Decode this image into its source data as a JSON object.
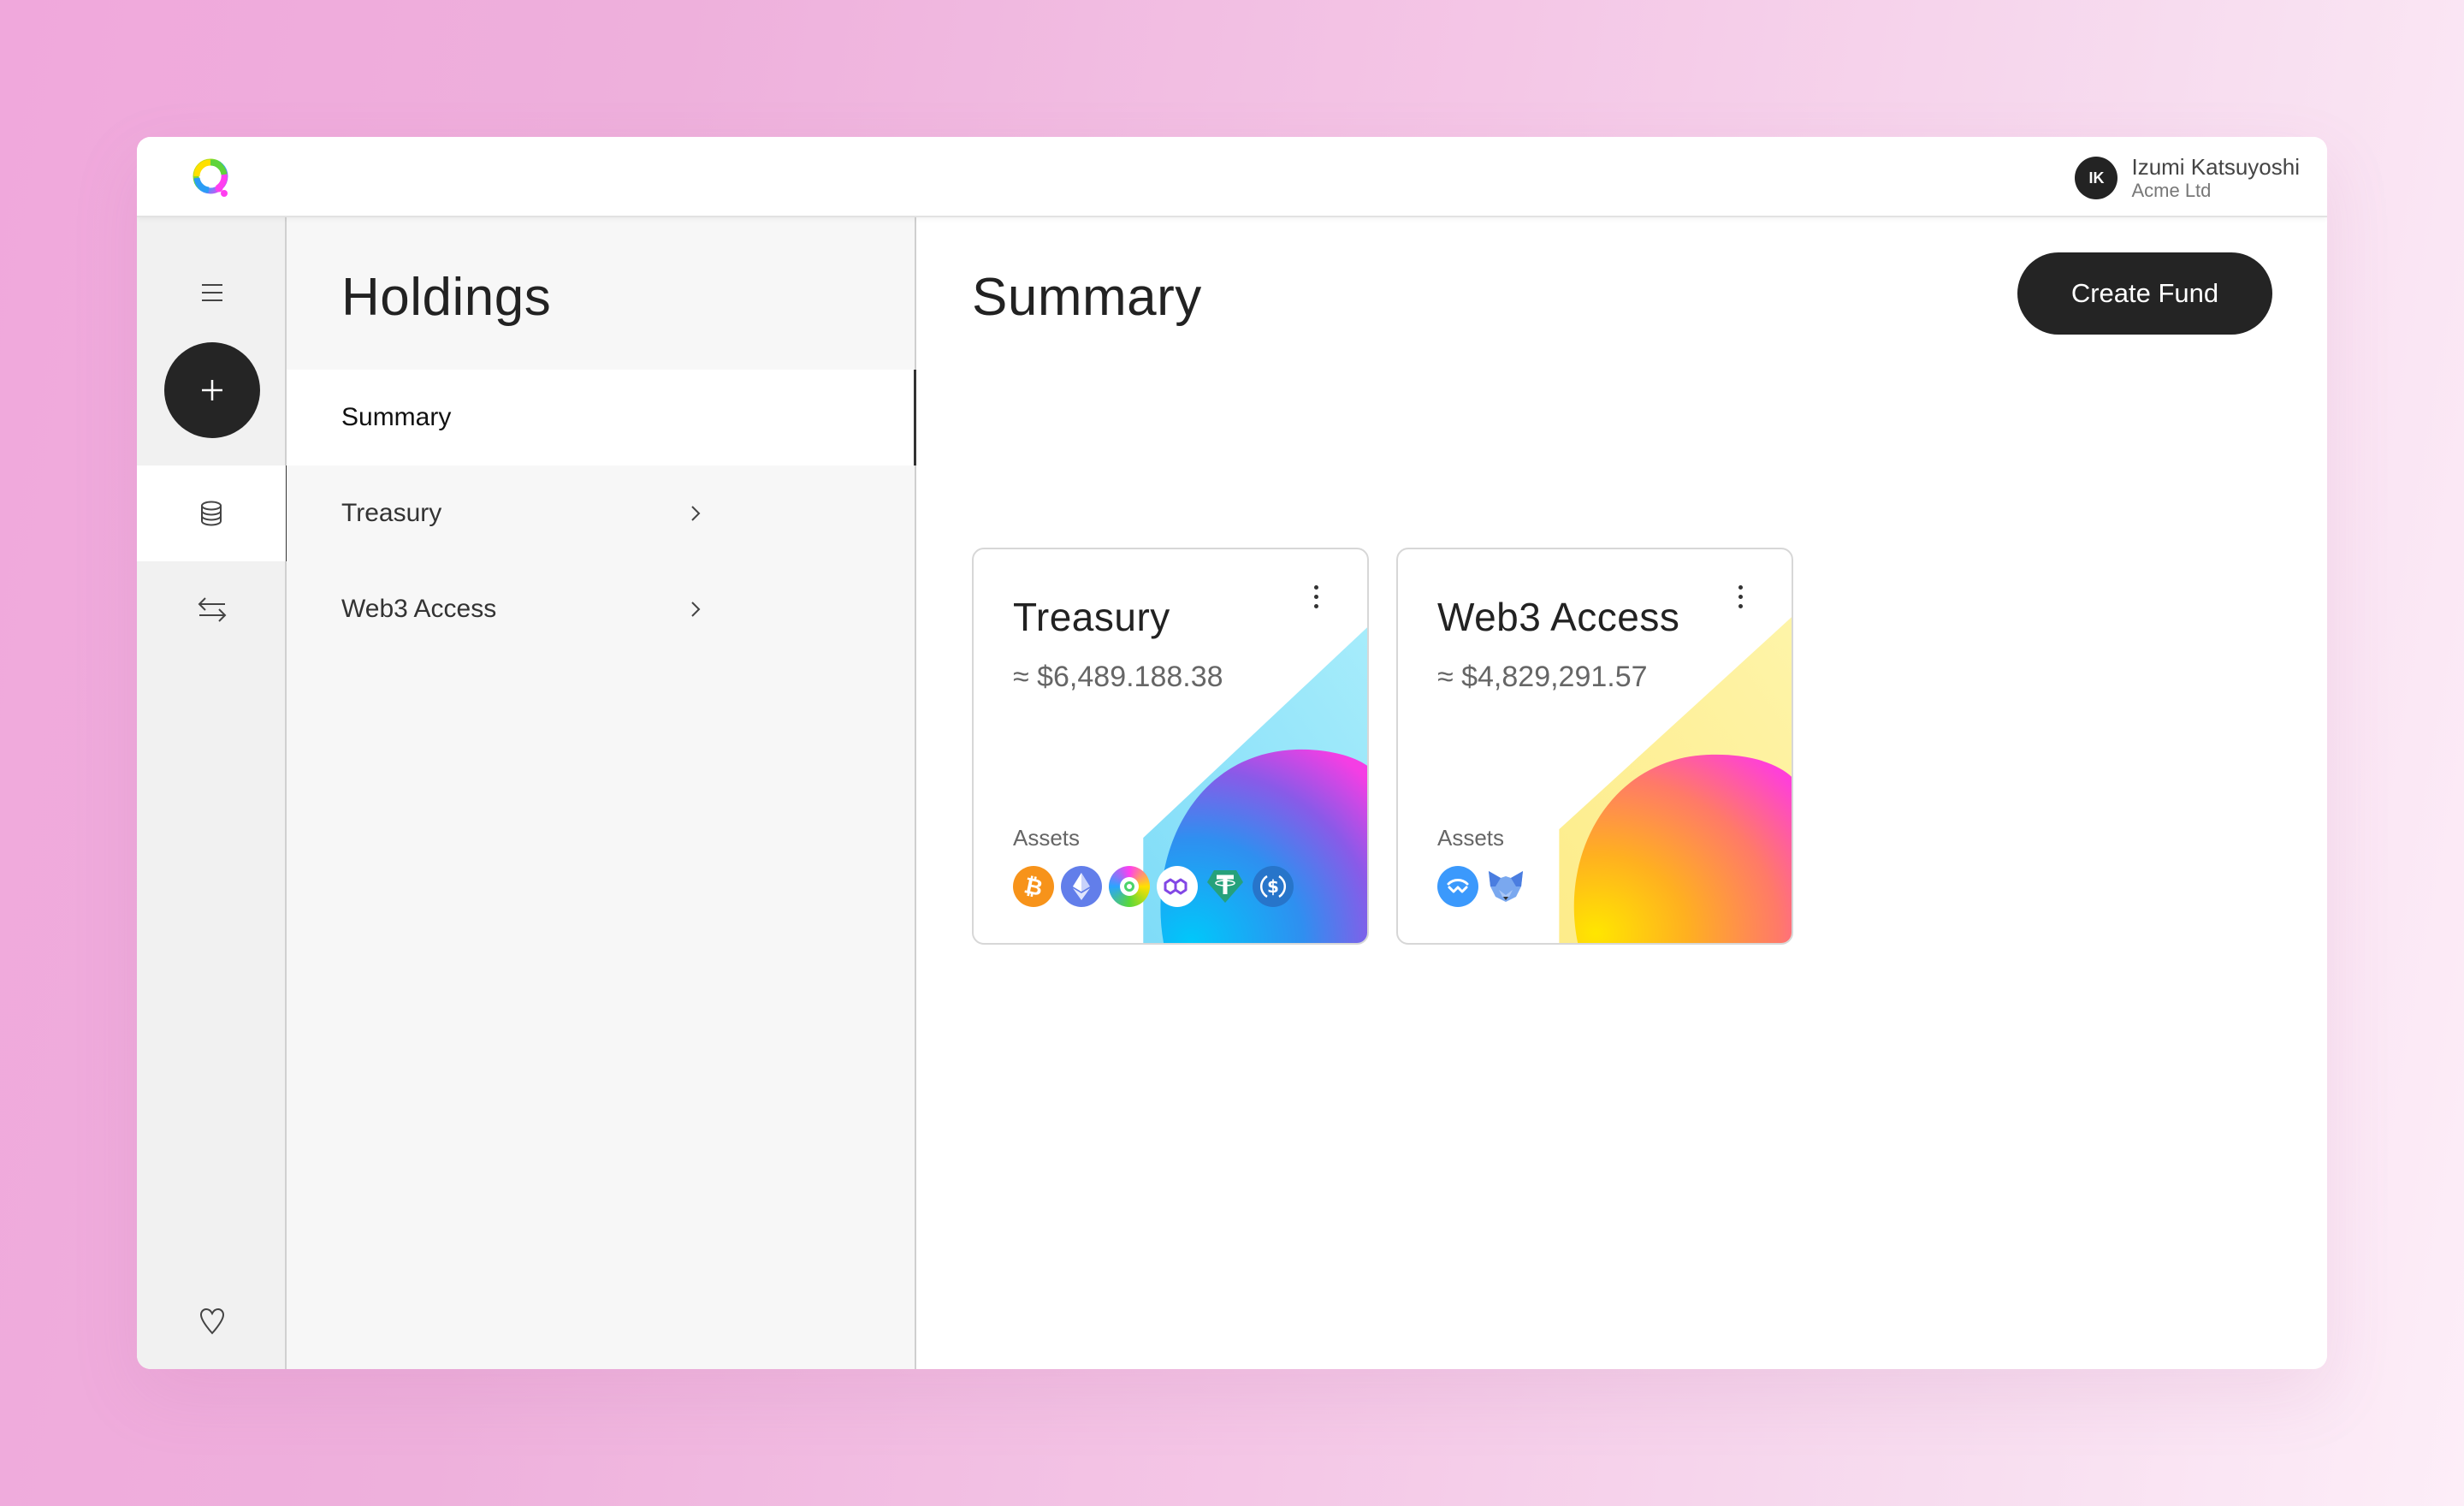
{
  "app": {
    "logo": "q-logo-icon"
  },
  "header": {
    "user": {
      "initials": "IK",
      "name": "Izumi Katsuyoshi",
      "organization": "Acme Ltd"
    }
  },
  "rail": {
    "items": [
      {
        "icon": "menu-icon"
      },
      {
        "icon": "plus-icon"
      },
      {
        "icon": "database-icon",
        "active": true
      },
      {
        "icon": "transfer-arrows-icon"
      },
      {
        "icon": "heart-icon"
      }
    ]
  },
  "nav": {
    "title": "Holdings",
    "items": [
      {
        "label": "Summary",
        "active": true
      },
      {
        "label": "Treasury",
        "has_chevron": true
      },
      {
        "label": "Web3 Access",
        "has_chevron": true
      }
    ]
  },
  "main": {
    "title": "Summary",
    "create_button": "Create Fund",
    "cards": [
      {
        "title": "Treasury",
        "value": "≈ $6,489.188.38",
        "assets_label": "Assets",
        "assets": [
          "bitcoin",
          "ethereum",
          "qredo",
          "polygon",
          "tether",
          "usd-coin"
        ],
        "accent_colors": [
          "#9fe6fb",
          "#00c0f8",
          "#3a8ef0",
          "#f040e0"
        ]
      },
      {
        "title": "Web3 Access",
        "value": "≈ $4,829,291.57",
        "assets_label": "Assets",
        "assets": [
          "walletconnect",
          "metamask"
        ],
        "accent_colors": [
          "#fdf0a0",
          "#ffe400",
          "#ff8c50",
          "#ff40d8"
        ]
      }
    ]
  }
}
